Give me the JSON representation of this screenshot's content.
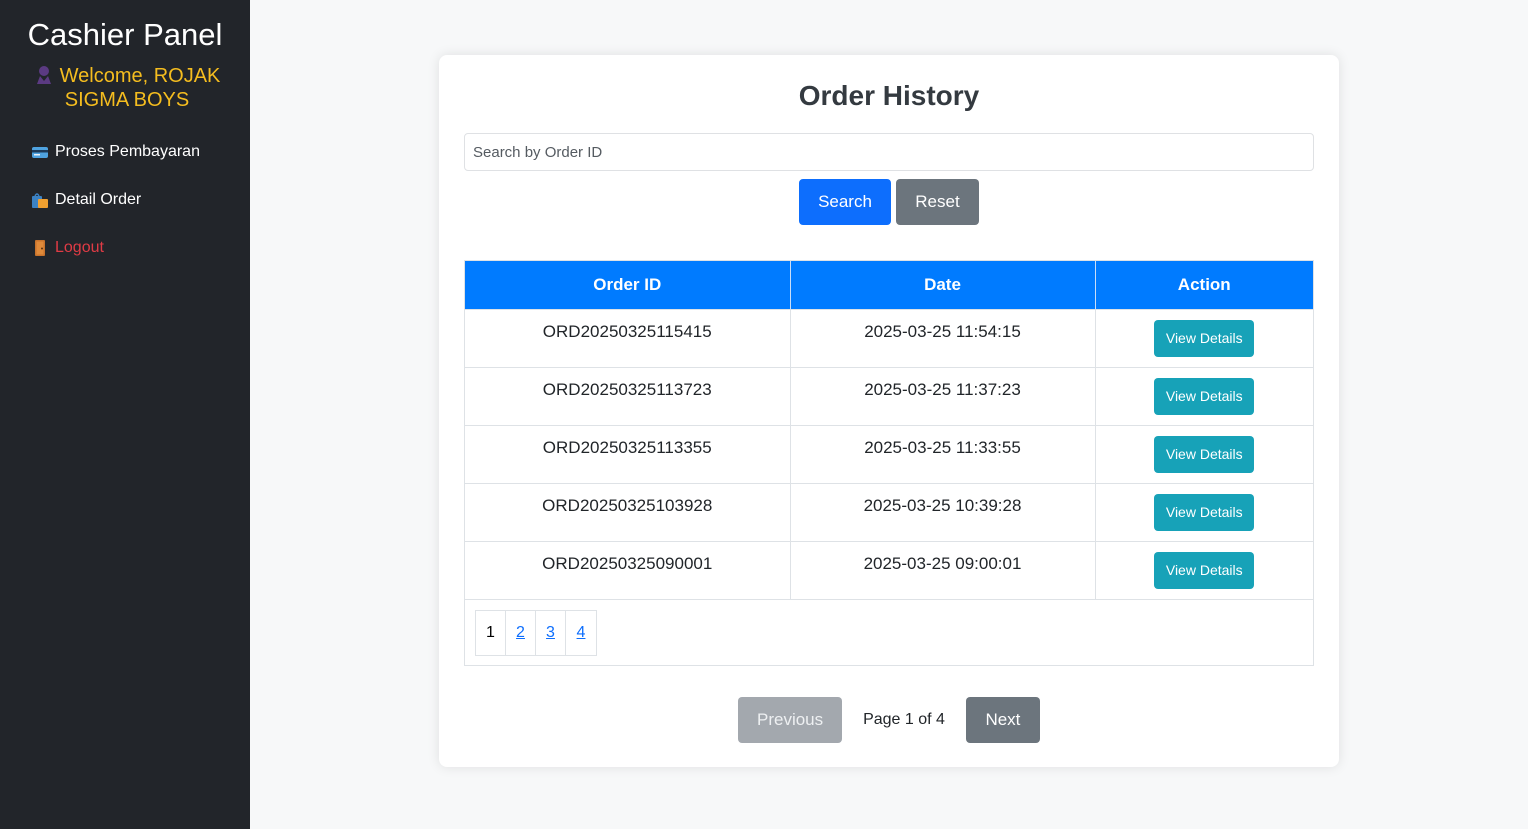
{
  "sidebar": {
    "brand": "Cashier Panel",
    "welcome": "Welcome, ROJAK SIGMA BOYS",
    "items": [
      {
        "label": "Proses Pembayaran",
        "icon": "credit-card-icon"
      },
      {
        "label": "Detail Order",
        "icon": "shopping-bags-icon"
      },
      {
        "label": "Logout",
        "icon": "door-icon"
      }
    ]
  },
  "main": {
    "title": "Order History",
    "search": {
      "placeholder": "Search by Order ID",
      "value": ""
    },
    "search_label": "Search",
    "reset_label": "Reset",
    "table": {
      "headers": [
        "Order ID",
        "Date",
        "Action"
      ],
      "rows": [
        {
          "order_id": "ORD20250325115415",
          "date": "2025-03-25 11:54:15",
          "action": "View Details"
        },
        {
          "order_id": "ORD20250325113723",
          "date": "2025-03-25 11:37:23",
          "action": "View Details"
        },
        {
          "order_id": "ORD20250325113355",
          "date": "2025-03-25 11:33:55",
          "action": "View Details"
        },
        {
          "order_id": "ORD20250325103928",
          "date": "2025-03-25 10:39:28",
          "action": "View Details"
        },
        {
          "order_id": "ORD20250325090001",
          "date": "2025-03-25 09:00:01",
          "action": "View Details"
        }
      ]
    },
    "pagination": {
      "current": "1",
      "links": [
        "2",
        "3",
        "4"
      ]
    },
    "previous_label": "Previous",
    "page_info": "Page 1 of 4",
    "next_label": "Next"
  },
  "colors": {
    "sidebar_bg": "#22252a",
    "welcome": "#f5bd1f",
    "logout": "#e03b45",
    "primary": "#0d6efd",
    "table_header": "#007bff",
    "info": "#17a2b8",
    "secondary": "#6c757d"
  }
}
